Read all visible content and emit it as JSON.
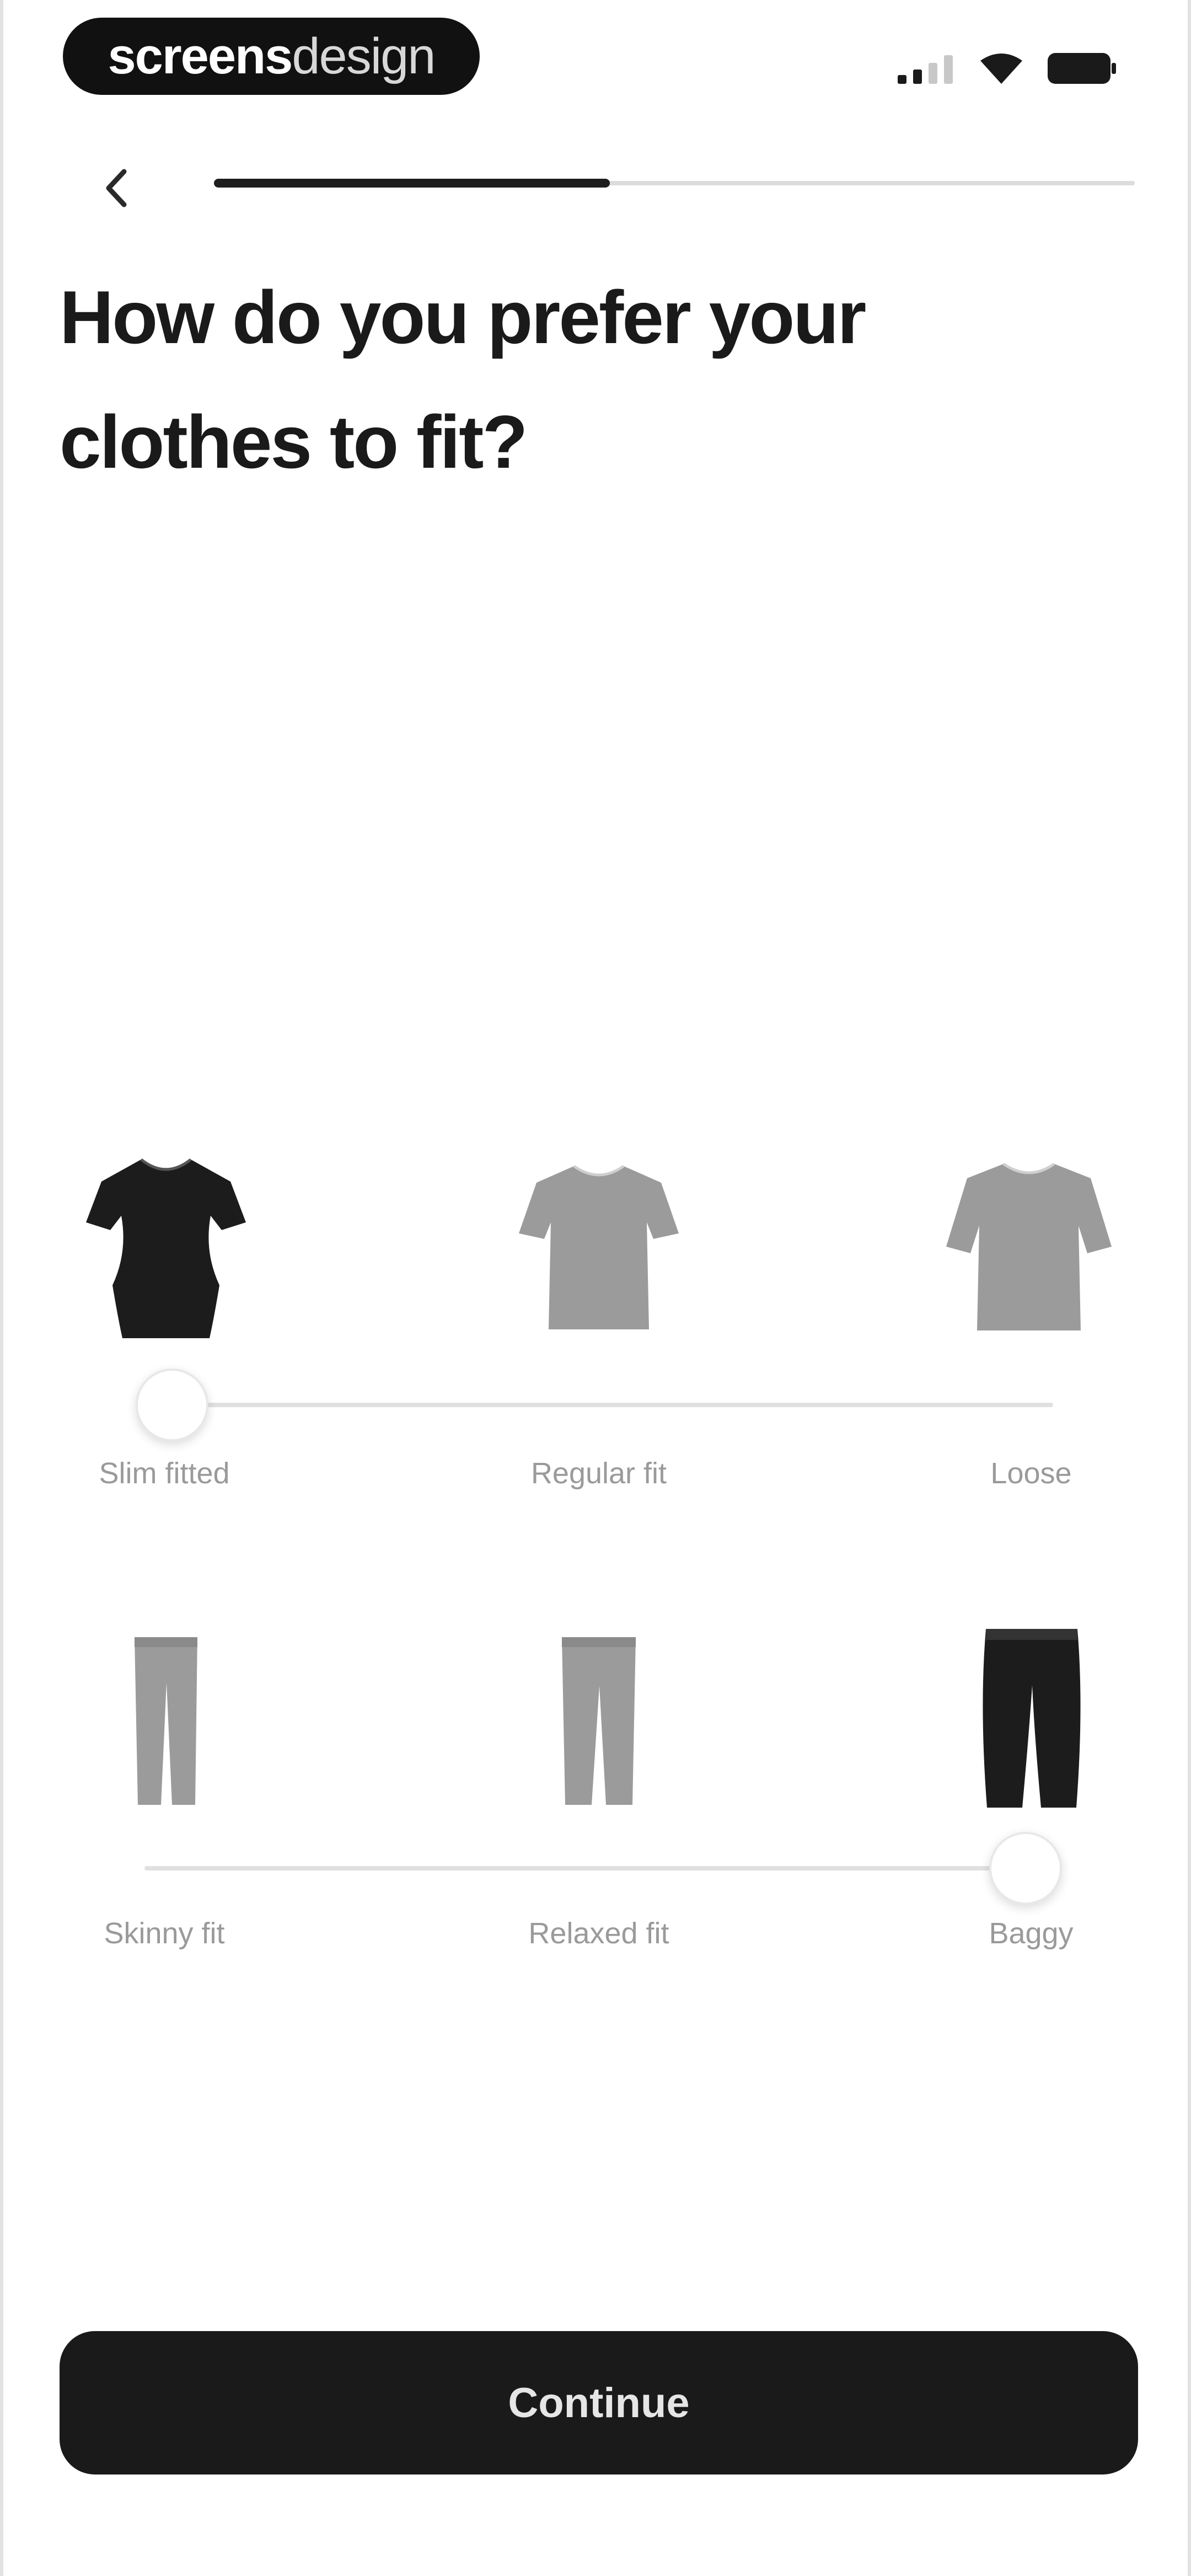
{
  "status_bar": {
    "brand_bold": "screens",
    "brand_light": "design",
    "icons": [
      "cellular-signal-icon",
      "wifi-icon",
      "battery-icon"
    ]
  },
  "nav": {
    "back_icon": "chevron-left-icon",
    "progress_fraction": 0.43
  },
  "title": {
    "line1": "How do you prefer your",
    "line2": "clothes to fit?"
  },
  "tops_fit": {
    "options": [
      "Slim fitted",
      "Regular fit",
      "Loose"
    ],
    "selected_index": 0,
    "icons": [
      "fitted-tshirt-icon",
      "regular-tshirt-icon",
      "loose-tshirt-icon"
    ]
  },
  "bottoms_fit": {
    "options": [
      "Skinny fit",
      "Relaxed fit",
      "Baggy"
    ],
    "selected_index": 2,
    "icons": [
      "skinny-pants-icon",
      "relaxed-pants-icon",
      "baggy-pants-icon"
    ]
  },
  "continue_label": "Continue",
  "colors": {
    "selected_garment": "#1c1c1c",
    "unselected_garment": "#9b9b9b",
    "button_background": "#1a1a1a",
    "label_text": "#9a9a9a"
  }
}
